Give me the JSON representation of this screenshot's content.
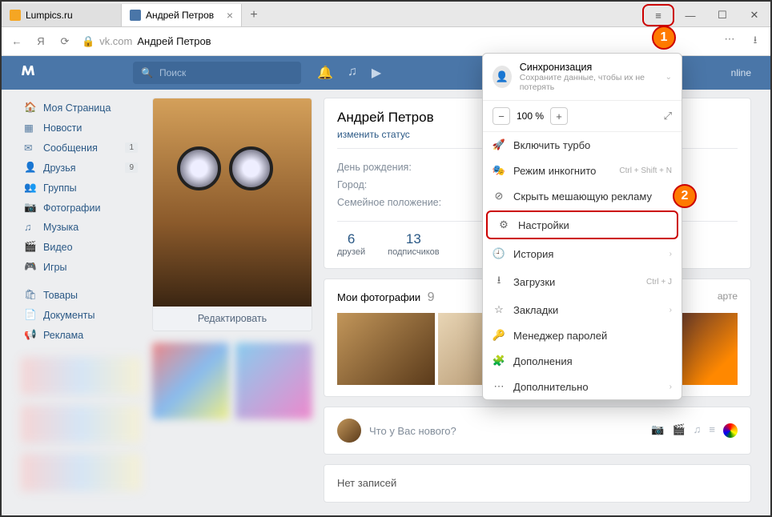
{
  "browser": {
    "tabs": [
      {
        "label": "Lumpics.ru",
        "fav_color": "#f5a623",
        "active": false
      },
      {
        "label": "Андрей Петров",
        "fav_color": "#4a76a8",
        "active": true
      }
    ],
    "url_domain": "vk.com",
    "url_title": "Андрей Петров",
    "zoom": "100 %",
    "sync_title": "Синхронизация",
    "sync_sub": "Сохраните данные, чтобы их не потерять",
    "menu": {
      "turbo": "Включить турбо",
      "incognito": "Режим инкогнито",
      "incognito_key": "Ctrl + Shift + N",
      "hideads": "Скрыть мешающую рекламу",
      "settings": "Настройки",
      "history": "История",
      "downloads": "Загрузки",
      "downloads_key": "Ctrl + J",
      "bookmarks": "Закладки",
      "passwords": "Менеджер паролей",
      "addons": "Дополнения",
      "more": "Дополнительно"
    }
  },
  "vk": {
    "search_placeholder": "Поиск",
    "online_text": "nline",
    "sidebar": {
      "items": [
        {
          "icon": "🏠",
          "label": "Моя Страница"
        },
        {
          "icon": "📰",
          "label": "Новости"
        },
        {
          "icon": "✉",
          "label": "Сообщения",
          "badge": "1"
        },
        {
          "icon": "👥",
          "label": "Друзья",
          "badge": "9"
        },
        {
          "icon": "👪",
          "label": "Группы"
        },
        {
          "icon": "📷",
          "label": "Фотографии"
        },
        {
          "icon": "♫",
          "label": "Музыка"
        },
        {
          "icon": "🎬",
          "label": "Видео"
        },
        {
          "icon": "🎮",
          "label": "Игры"
        }
      ],
      "extra": [
        {
          "icon": "🛍",
          "label": "Товары"
        },
        {
          "icon": "📄",
          "label": "Документы"
        },
        {
          "icon": "📢",
          "label": "Реклама"
        }
      ]
    },
    "profile": {
      "edit_btn": "Редактировать",
      "name": "Андрей Петров",
      "status_link": "изменить статус",
      "birthday_label": "День рождения:",
      "city_label": "Город:",
      "relation_label": "Семейное положение:",
      "friends_n": "6",
      "friends_l": "друзей",
      "subs_n": "13",
      "subs_l": "подписчиков",
      "photos_title": "Мои фотографии",
      "photos_count": "9",
      "map_hint": "арте",
      "composer_placeholder": "Что у Вас нового?",
      "no_posts": "Нет записей"
    }
  },
  "callouts": {
    "one": "1",
    "two": "2"
  }
}
